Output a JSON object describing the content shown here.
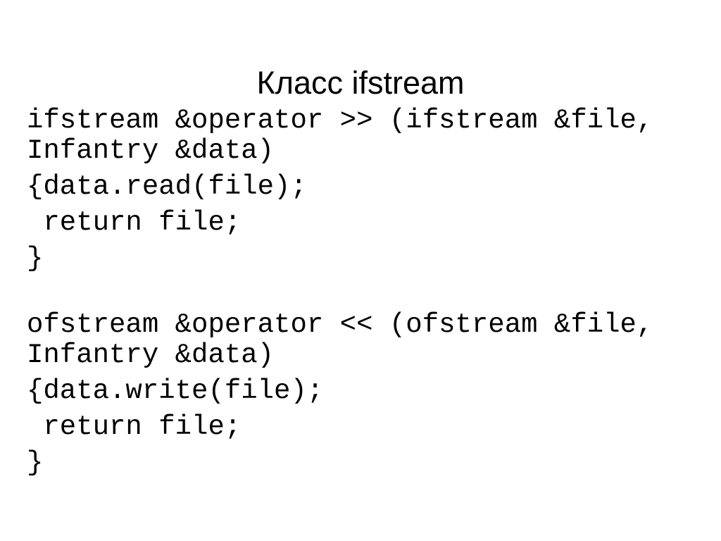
{
  "slide": {
    "title": "Класс ifstream",
    "background_color": "#ffffff",
    "text_color": "#000000",
    "code_lines": [
      "ifstream &operator >> (ifstream &file, Infantry &data)",
      "{data.read(file);",
      " return file;",
      "}",
      "",
      "ofstream &operator << (ofstream &file, Infantry &data)",
      "{data.write(file);",
      " return file;",
      "}"
    ]
  }
}
